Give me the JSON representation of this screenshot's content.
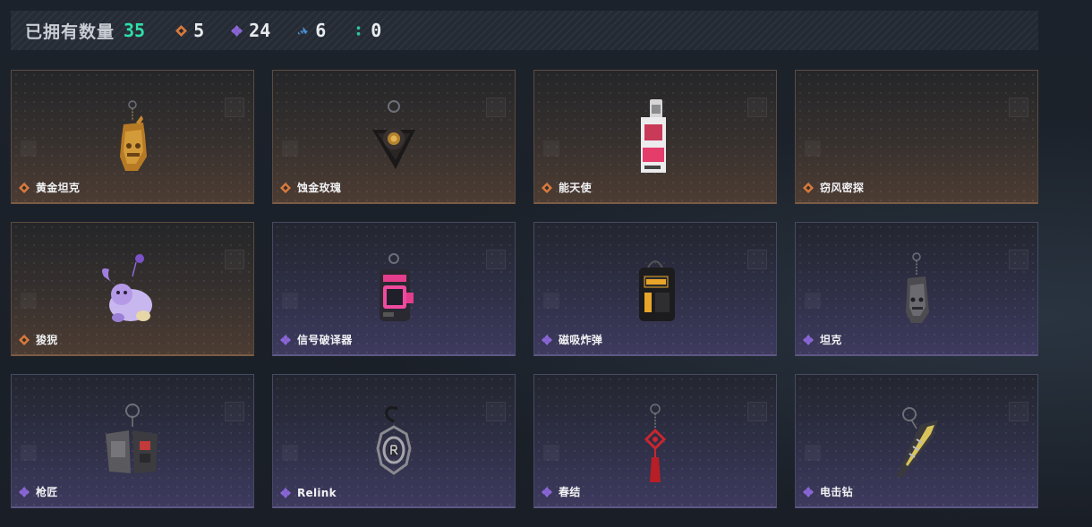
{
  "header": {
    "owned_label": "已拥有数量",
    "owned_count": "35",
    "stats": [
      {
        "rarity": "orange",
        "icon": "orange-diamond-icon",
        "color": "#d97a3c",
        "count": "5"
      },
      {
        "rarity": "purple",
        "icon": "purple-diamond-icon",
        "color": "#8a66d6",
        "count": "24"
      },
      {
        "rarity": "blue",
        "icon": "blue-diamond-icon",
        "color": "#4a8fd0",
        "count": "6"
      },
      {
        "rarity": "green",
        "icon": "green-dots-icon",
        "color": "#2bc79a",
        "count": "0"
      }
    ]
  },
  "colors": {
    "accent_green": "#2fe0a8",
    "orange_rarity": "#d97a3c",
    "purple_rarity": "#8a66d6"
  },
  "items": [
    {
      "name": "黄金坦克",
      "rarity": "orange",
      "icon": "golden-tank-charm-icon"
    },
    {
      "name": "蚀金玫瑰",
      "rarity": "orange",
      "icon": "black-rose-charm-icon"
    },
    {
      "name": "能天使",
      "rarity": "orange",
      "icon": "exusiai-tag-charm-icon"
    },
    {
      "name": "窃风密探",
      "rarity": "orange",
      "icon": "empty-charm-slot"
    },
    {
      "name": "狻猊",
      "rarity": "orange",
      "icon": "suanni-lion-charm-icon"
    },
    {
      "name": "信号破译器",
      "rarity": "purple",
      "icon": "signal-decoder-charm-icon"
    },
    {
      "name": "磁吸炸弹",
      "rarity": "purple",
      "icon": "magnetic-bomb-charm-icon"
    },
    {
      "name": "坦克",
      "rarity": "purple",
      "icon": "tank-charm-icon"
    },
    {
      "name": "枪匠",
      "rarity": "purple",
      "icon": "gunsmith-charm-icon"
    },
    {
      "name": "Relink",
      "rarity": "purple",
      "icon": "relink-charm-icon"
    },
    {
      "name": "春结",
      "rarity": "purple",
      "icon": "chinese-knot-charm-icon"
    },
    {
      "name": "电击钻",
      "rarity": "purple",
      "icon": "shock-drill-charm-icon"
    }
  ]
}
